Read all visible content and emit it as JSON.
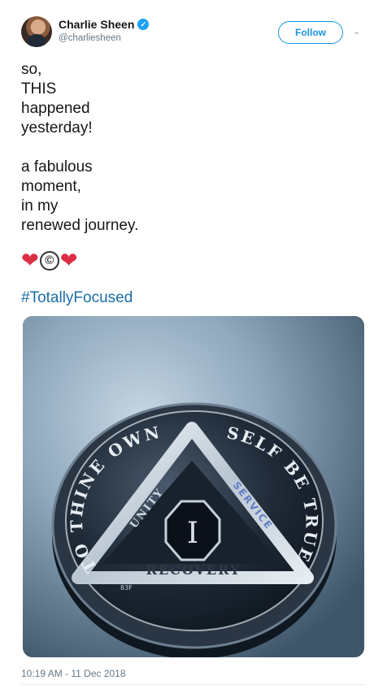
{
  "author": {
    "display_name": "Charlie Sheen",
    "handle": "@charliesheen",
    "verified": true
  },
  "actions": {
    "follow_label": "Follow"
  },
  "tweet": {
    "lines": [
      "so,",
      "THIS",
      "happened",
      "yesterday!",
      "",
      "a fabulous",
      "moment,",
      "in my",
      "renewed journey."
    ],
    "emoji": [
      "❤",
      "©",
      "❤"
    ],
    "hashtag": "#TotallyFocused",
    "timestamp": "10:19 AM - 11 Dec 2018"
  },
  "media": {
    "coin_top_left": "TO THINE OWN",
    "coin_top_right": "SELF BE TRUE",
    "coin_left_side": "UNITY",
    "coin_right_side": "SERVICE",
    "coin_bottom": "RECOVERY",
    "coin_center": "I",
    "coin_mark": "83F"
  },
  "colors": {
    "link": "#1b6ea8",
    "follow": "#1b95e0",
    "verified": "#1da1f2",
    "heart": "#dd2e44"
  }
}
